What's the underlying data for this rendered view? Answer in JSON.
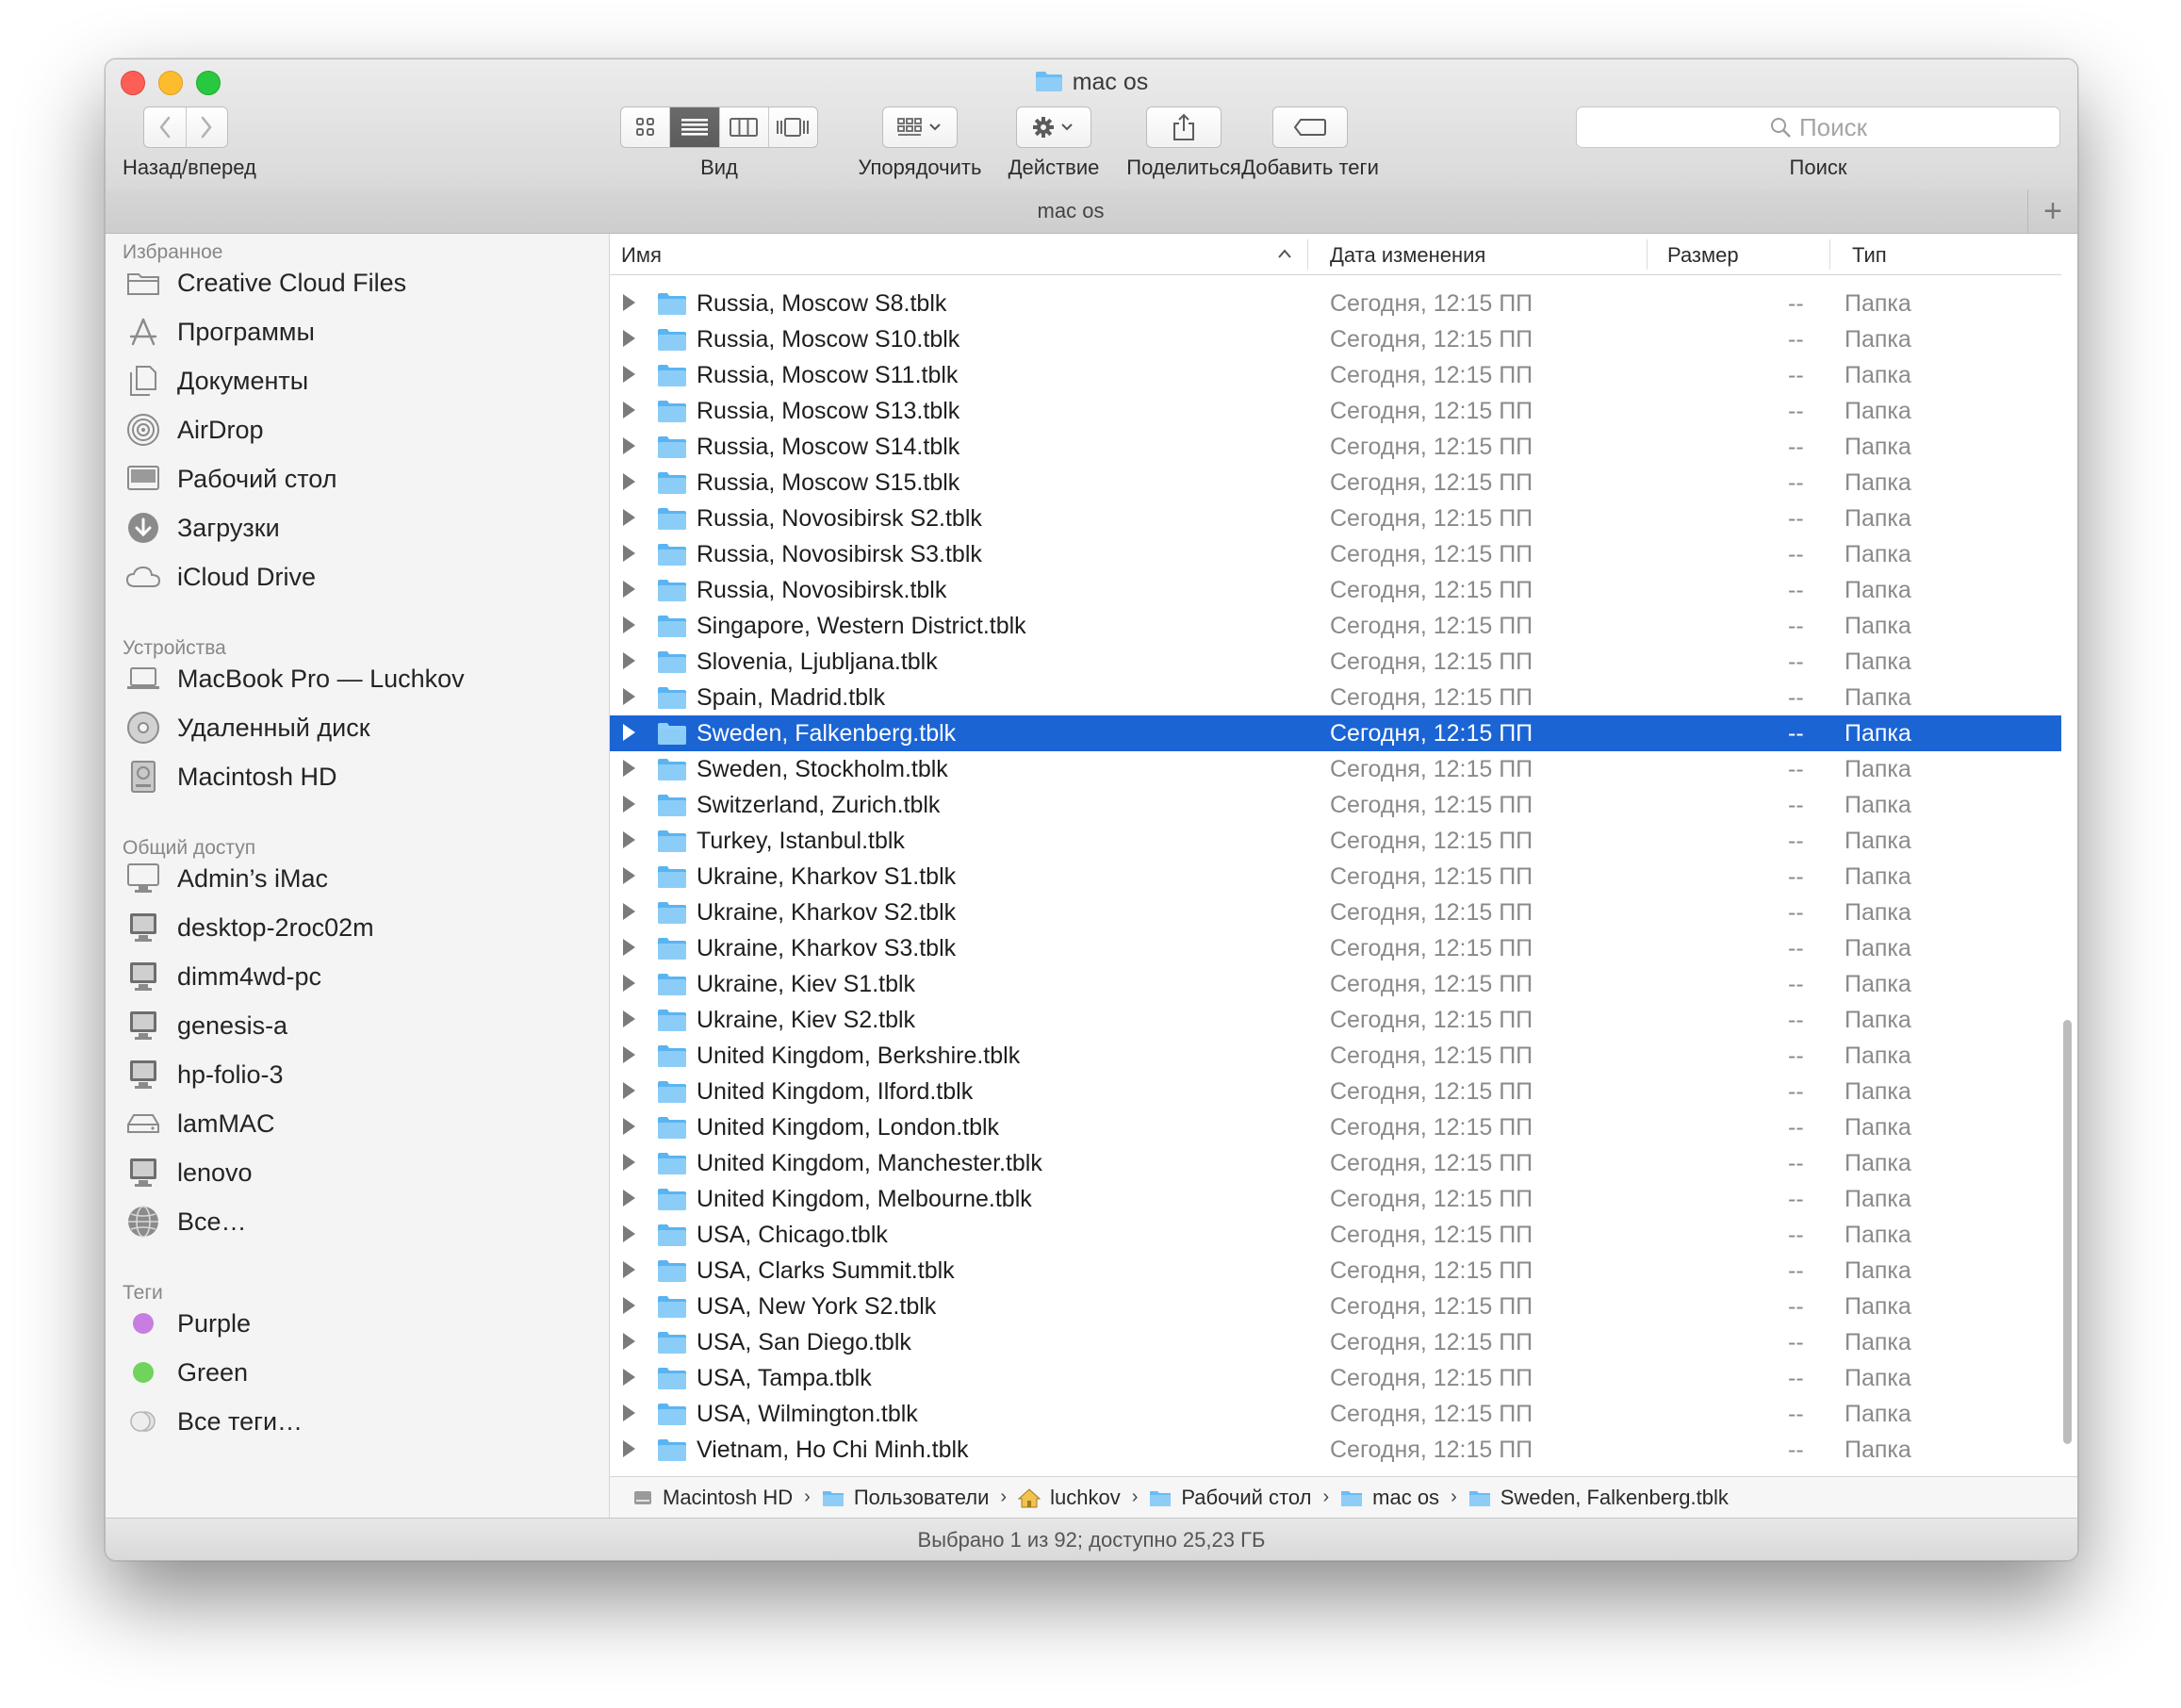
{
  "window": {
    "title": "mac os",
    "tab_title": "mac os"
  },
  "toolbar": {
    "back_forward_label": "Назад/вперед",
    "view_label": "Вид",
    "arrange_label": "Упорядочить",
    "action_label": "Действие",
    "share_label": "Поделиться",
    "tags_label": "Добавить теги",
    "search_label": "Поиск",
    "search_placeholder": "Поиск",
    "active_view": "list"
  },
  "sidebar": {
    "favorites_heading": "Избранное",
    "favorites": [
      {
        "label": "Creative Cloud Files",
        "icon": "folder-icon"
      },
      {
        "label": "Программы",
        "icon": "applications-icon"
      },
      {
        "label": "Документы",
        "icon": "documents-icon"
      },
      {
        "label": "AirDrop",
        "icon": "airdrop-icon"
      },
      {
        "label": "Рабочий стол",
        "icon": "desktop-icon"
      },
      {
        "label": "Загрузки",
        "icon": "downloads-icon"
      },
      {
        "label": "iCloud Drive",
        "icon": "cloud-icon"
      }
    ],
    "devices_heading": "Устройства",
    "devices": [
      {
        "label": "MacBook Pro — Luchkov",
        "icon": "laptop-icon"
      },
      {
        "label": "Удаленный диск",
        "icon": "optical-disc-icon"
      },
      {
        "label": "Macintosh HD",
        "icon": "hard-drive-icon"
      }
    ],
    "shared_heading": "Общий доступ",
    "shared": [
      {
        "label": "Admin’s iMac",
        "icon": "imac-icon"
      },
      {
        "label": "desktop-2roc02m",
        "icon": "pc-monitor-icon"
      },
      {
        "label": "dimm4wd-pc",
        "icon": "pc-monitor-icon"
      },
      {
        "label": "genesis-a",
        "icon": "pc-monitor-icon"
      },
      {
        "label": "hp-folio-3",
        "icon": "pc-monitor-icon"
      },
      {
        "label": "lamMAC",
        "icon": "network-drive-icon"
      },
      {
        "label": "lenovo",
        "icon": "pc-monitor-icon"
      },
      {
        "label": "Все…",
        "icon": "globe-icon"
      }
    ],
    "tags_heading": "Теги",
    "tags": [
      {
        "label": "Purple",
        "color": "#c77ee0"
      },
      {
        "label": "Green",
        "color": "#6fd35c"
      },
      {
        "label": "Все теги…",
        "color": "#d4d4d4"
      }
    ]
  },
  "list": {
    "columns": {
      "name": "Имя",
      "date": "Дата изменения",
      "size": "Размер",
      "kind": "Тип"
    },
    "sort_indicator": "^",
    "selected_index": 12,
    "rows": [
      {
        "name": "Russia, Moscow S8.tblk",
        "date": "Сегодня, 12:15 ПП",
        "size": "--",
        "kind": "Папка"
      },
      {
        "name": "Russia, Moscow S10.tblk",
        "date": "Сегодня, 12:15 ПП",
        "size": "--",
        "kind": "Папка"
      },
      {
        "name": "Russia, Moscow S11.tblk",
        "date": "Сегодня, 12:15 ПП",
        "size": "--",
        "kind": "Папка"
      },
      {
        "name": "Russia, Moscow S13.tblk",
        "date": "Сегодня, 12:15 ПП",
        "size": "--",
        "kind": "Папка"
      },
      {
        "name": "Russia, Moscow S14.tblk",
        "date": "Сегодня, 12:15 ПП",
        "size": "--",
        "kind": "Папка"
      },
      {
        "name": "Russia, Moscow S15.tblk",
        "date": "Сегодня, 12:15 ПП",
        "size": "--",
        "kind": "Папка"
      },
      {
        "name": "Russia, Novosibirsk S2.tblk",
        "date": "Сегодня, 12:15 ПП",
        "size": "--",
        "kind": "Папка"
      },
      {
        "name": "Russia, Novosibirsk S3.tblk",
        "date": "Сегодня, 12:15 ПП",
        "size": "--",
        "kind": "Папка"
      },
      {
        "name": "Russia, Novosibirsk.tblk",
        "date": "Сегодня, 12:15 ПП",
        "size": "--",
        "kind": "Папка"
      },
      {
        "name": "Singapore, Western District.tblk",
        "date": "Сегодня, 12:15 ПП",
        "size": "--",
        "kind": "Папка"
      },
      {
        "name": "Slovenia, Ljubljana.tblk",
        "date": "Сегодня, 12:15 ПП",
        "size": "--",
        "kind": "Папка"
      },
      {
        "name": "Spain, Madrid.tblk",
        "date": "Сегодня, 12:15 ПП",
        "size": "--",
        "kind": "Папка"
      },
      {
        "name": "Sweden, Falkenberg.tblk",
        "date": "Сегодня, 12:15 ПП",
        "size": "--",
        "kind": "Папка"
      },
      {
        "name": "Sweden, Stockholm.tblk",
        "date": "Сегодня, 12:15 ПП",
        "size": "--",
        "kind": "Папка"
      },
      {
        "name": "Switzerland, Zurich.tblk",
        "date": "Сегодня, 12:15 ПП",
        "size": "--",
        "kind": "Папка"
      },
      {
        "name": "Turkey, Istanbul.tblk",
        "date": "Сегодня, 12:15 ПП",
        "size": "--",
        "kind": "Папка"
      },
      {
        "name": "Ukraine, Kharkov S1.tblk",
        "date": "Сегодня, 12:15 ПП",
        "size": "--",
        "kind": "Папка"
      },
      {
        "name": "Ukraine, Kharkov S2.tblk",
        "date": "Сегодня, 12:15 ПП",
        "size": "--",
        "kind": "Папка"
      },
      {
        "name": "Ukraine, Kharkov S3.tblk",
        "date": "Сегодня, 12:15 ПП",
        "size": "--",
        "kind": "Папка"
      },
      {
        "name": "Ukraine, Kiev S1.tblk",
        "date": "Сегодня, 12:15 ПП",
        "size": "--",
        "kind": "Папка"
      },
      {
        "name": "Ukraine, Kiev S2.tblk",
        "date": "Сегодня, 12:15 ПП",
        "size": "--",
        "kind": "Папка"
      },
      {
        "name": "United Kingdom, Berkshire.tblk",
        "date": "Сегодня, 12:15 ПП",
        "size": "--",
        "kind": "Папка"
      },
      {
        "name": "United Kingdom, Ilford.tblk",
        "date": "Сегодня, 12:15 ПП",
        "size": "--",
        "kind": "Папка"
      },
      {
        "name": "United Kingdom, London.tblk",
        "date": "Сегодня, 12:15 ПП",
        "size": "--",
        "kind": "Папка"
      },
      {
        "name": "United Kingdom, Manchester.tblk",
        "date": "Сегодня, 12:15 ПП",
        "size": "--",
        "kind": "Папка"
      },
      {
        "name": "United Kingdom, Melbourne.tblk",
        "date": "Сегодня, 12:15 ПП",
        "size": "--",
        "kind": "Папка"
      },
      {
        "name": "USA, Chicago.tblk",
        "date": "Сегодня, 12:15 ПП",
        "size": "--",
        "kind": "Папка"
      },
      {
        "name": "USA, Clarks Summit.tblk",
        "date": "Сегодня, 12:15 ПП",
        "size": "--",
        "kind": "Папка"
      },
      {
        "name": "USA, New York S2.tblk",
        "date": "Сегодня, 12:15 ПП",
        "size": "--",
        "kind": "Папка"
      },
      {
        "name": "USA, San Diego.tblk",
        "date": "Сегодня, 12:15 ПП",
        "size": "--",
        "kind": "Папка"
      },
      {
        "name": "USA, Tampa.tblk",
        "date": "Сегодня, 12:15 ПП",
        "size": "--",
        "kind": "Папка"
      },
      {
        "name": "USA, Wilmington.tblk",
        "date": "Сегодня, 12:15 ПП",
        "size": "--",
        "kind": "Папка"
      },
      {
        "name": "Vietnam, Ho Chi Minh.tblk",
        "date": "Сегодня, 12:15 ПП",
        "size": "--",
        "kind": "Папка"
      }
    ]
  },
  "pathbar": [
    {
      "label": "Macintosh HD",
      "icon": "hard-drive-icon"
    },
    {
      "label": "Пользователи",
      "icon": "folder-icon"
    },
    {
      "label": "luchkov",
      "icon": "home-icon"
    },
    {
      "label": "Рабочий стол",
      "icon": "folder-icon"
    },
    {
      "label": "mac os",
      "icon": "folder-icon"
    },
    {
      "label": "Sweden, Falkenberg.tblk",
      "icon": "folder-icon"
    }
  ],
  "status": "Выбрано 1 из 92; доступно 25,23 ГБ",
  "colors": {
    "selection": "#1b64d4",
    "folder": "#5ab4f1"
  }
}
